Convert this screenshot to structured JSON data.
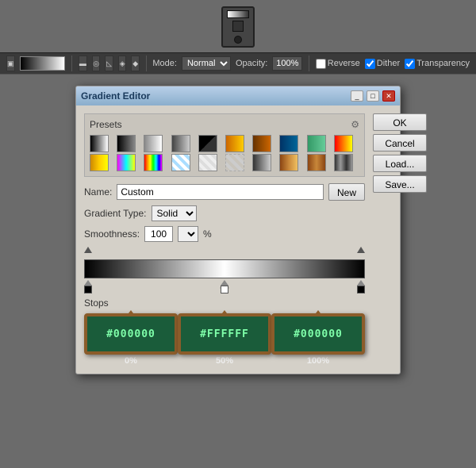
{
  "toolbar": {
    "mode_label": "Mode:",
    "mode_value": "Normal",
    "opacity_label": "Opacity:",
    "opacity_value": "100%",
    "reverse_label": "Reverse",
    "dither_label": "Dither",
    "transparency_label": "Transparency"
  },
  "dialog": {
    "title": "Gradient Editor",
    "buttons": {
      "ok": "OK",
      "cancel": "Cancel",
      "load": "Load...",
      "save": "Save..."
    },
    "presets_label": "Presets",
    "name_label": "Name:",
    "name_value": "Custom",
    "new_label": "New",
    "gradient_type_label": "Gradient Type:",
    "gradient_type_value": "Solid",
    "smoothness_label": "Smoothness:",
    "smoothness_value": "100",
    "smoothness_unit": "%",
    "stops_label": "Stops",
    "color_stops": [
      {
        "color": "#000000",
        "percent": "0%"
      },
      {
        "color": "#FFFFFF",
        "percent": "50%"
      },
      {
        "color": "#000000",
        "percent": "100%"
      }
    ]
  }
}
